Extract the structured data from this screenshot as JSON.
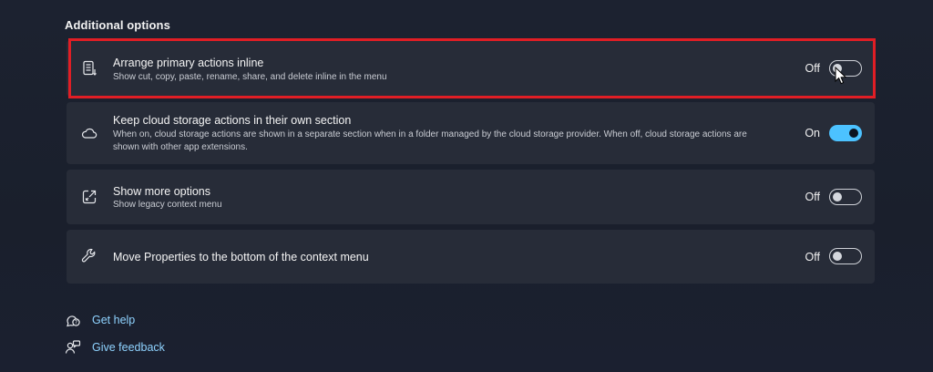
{
  "section": {
    "title": "Additional options"
  },
  "options": [
    {
      "icon": "list-inline-icon",
      "title": "Arrange primary actions inline",
      "description": "Show cut, copy, paste, rename, share, and delete inline in the menu",
      "state_label": "Off",
      "state": false
    },
    {
      "icon": "cloud-icon",
      "title": "Keep cloud storage actions in their own section",
      "description": "When on, cloud storage actions are shown in a separate section when in a folder managed by the cloud storage provider. When off, cloud storage actions are shown with other app extensions.",
      "state_label": "On",
      "state": true
    },
    {
      "icon": "open-external-icon",
      "title": "Show more options",
      "description": "Show legacy context menu",
      "state_label": "Off",
      "state": false
    },
    {
      "icon": "wrench-icon",
      "title": "Move Properties to the bottom of the context menu",
      "state_label": "Off",
      "state": false
    }
  ],
  "links": {
    "help": {
      "label": "Get help",
      "icon": "help-icon"
    },
    "feedback": {
      "label": "Give feedback",
      "icon": "feedback-icon"
    }
  },
  "colors": {
    "accent": "#4cc2ff",
    "highlight": "#e01e25",
    "card": "#272c38",
    "background": "#1c2230",
    "link": "#8fd3ff"
  }
}
